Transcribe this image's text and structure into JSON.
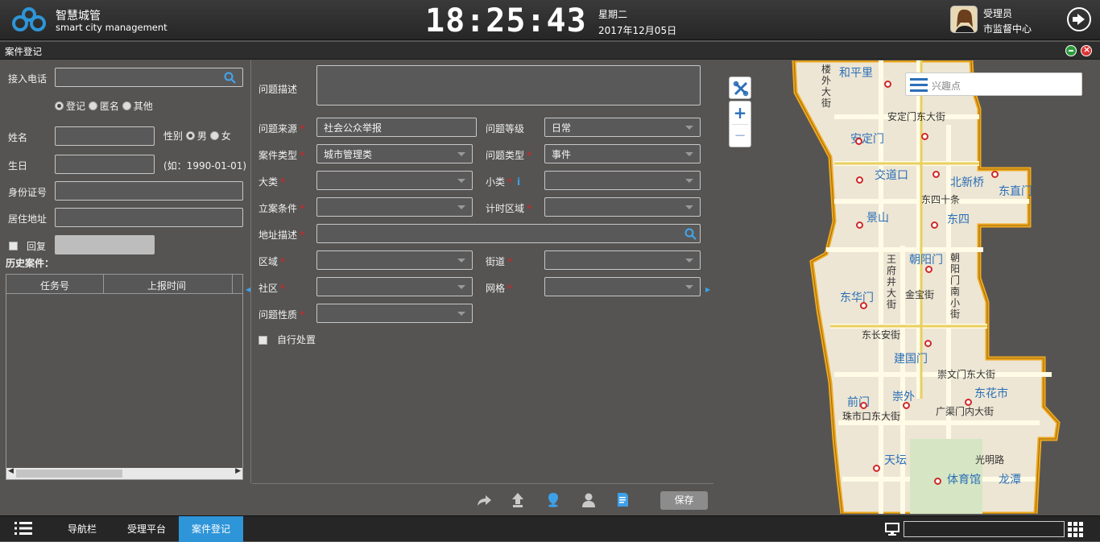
{
  "header": {
    "brand_cn": "智慧城管",
    "brand_en": "smart city management",
    "clock": "18:25:43",
    "weekday": "星期二",
    "date": "2017年12月05日",
    "role": "受理员",
    "department": "市监督中心"
  },
  "window": {
    "title": "案件登记"
  },
  "left_form": {
    "phone_label": "接入电话",
    "radio_register": "登记",
    "radio_anonymous": "匿名",
    "radio_other": "其他",
    "name_label": "姓名",
    "gender_label": "性别",
    "gender_male": "男",
    "gender_female": "女",
    "birthday_label": "生日",
    "birthday_hint": "(如：1990-01-01)",
    "id_label": "身份证号",
    "address_label": "居住地址",
    "reply_label": "回复",
    "history_label": "历史案件：",
    "col_task": "任务号",
    "col_time": "上报时间"
  },
  "main_form": {
    "desc_label": "问题描述",
    "source_label": "问题来源",
    "source_value": "社会公众举报",
    "level_label": "问题等级",
    "level_value": "日常",
    "case_type_label": "案件类型",
    "case_type_value": "城市管理类",
    "problem_type_label": "问题类型",
    "problem_type_value": "事件",
    "major_label": "大类",
    "minor_label": "小类",
    "filing_label": "立案条件",
    "timing_label": "计时区域",
    "addr_desc_label": "地址描述",
    "district_label": "区域",
    "street_label": "街道",
    "community_label": "社区",
    "grid_label": "网格",
    "nature_label": "问题性质",
    "self_handle_label": "自行处置",
    "save_label": "保存"
  },
  "map": {
    "poi_placeholder": "兴趣点",
    "zoom_in": "+",
    "zoom_out": "−",
    "labels": [
      "和平里",
      "安定门",
      "交道口",
      "北新桥",
      "东直门",
      "景山",
      "东四",
      "朝阳门",
      "东华门",
      "建国门",
      "前门",
      "崇外",
      "东花市",
      "天坛",
      "体育馆",
      "龙潭"
    ],
    "streets": [
      "安定门东大街",
      "东四十条",
      "东长安街",
      "金宝街",
      "崇文门东大街",
      "广渠门内大街",
      "珠市口东大街",
      "光明路",
      "楼外大街",
      "王府井大街",
      "朝阳门南小街"
    ]
  },
  "taskbar": {
    "tab_nav": "导航栏",
    "tab_platform": "受理平台",
    "tab_case": "案件登记"
  }
}
